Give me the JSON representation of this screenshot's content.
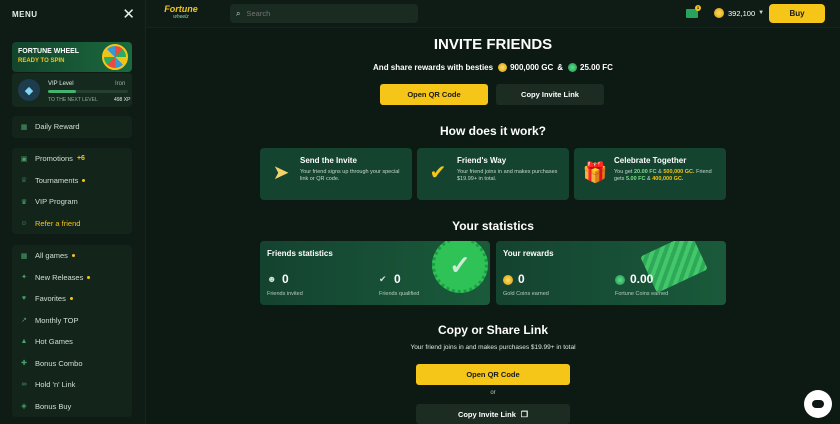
{
  "sidebar": {
    "menu_label": "MENU",
    "fortune_wheel": {
      "title": "FORTUNE WHEEL",
      "status": "READY TO SPIN"
    },
    "vip": {
      "label": "VIP Level",
      "rank": "Iron",
      "next_label": "TO THE NEXT LEVEL",
      "xp": "498 XP",
      "progress": 0.35
    },
    "group1": [
      {
        "label": "Daily Reward",
        "icon": "calendar-icon"
      }
    ],
    "group2": [
      {
        "label": "Promotions",
        "icon": "gift-icon",
        "extra": "+6"
      },
      {
        "label": "Tournaments",
        "icon": "trophy-icon",
        "dot": true
      },
      {
        "label": "VIP Program",
        "icon": "crown-icon"
      },
      {
        "label": "Refer a friend",
        "icon": "users-icon",
        "accent": true
      }
    ],
    "group3": [
      {
        "label": "All games",
        "icon": "grid-icon",
        "dot": true
      },
      {
        "label": "New Releases",
        "icon": "sparkle-icon",
        "dot": true
      },
      {
        "label": "Favorites",
        "icon": "heart-icon",
        "dot": true
      },
      {
        "label": "Monthly TOP",
        "icon": "trending-icon"
      },
      {
        "label": "Hot Games",
        "icon": "fire-icon"
      },
      {
        "label": "Bonus Combo",
        "icon": "combo-icon"
      },
      {
        "label": "Hold 'n' Link",
        "icon": "link-icon"
      },
      {
        "label": "Bonus Buy",
        "icon": "cart-icon"
      }
    ]
  },
  "topbar": {
    "logo_main": "Fortune",
    "logo_sub": "wheelz",
    "search_placeholder": "Search",
    "notification_count": "1",
    "balance": "392,100",
    "buy_label": "Buy"
  },
  "invite": {
    "title": "INVITE FRIENDS",
    "subtitle": "And share rewards with besties",
    "gc_amount": "900,000",
    "gc_unit": "GC",
    "amp": "&",
    "fc_amount": "25.00",
    "fc_unit": "FC",
    "qr_button": "Open QR Code",
    "copy_button": "Copy Invite Link"
  },
  "how": {
    "title": "How does it work?",
    "cards": [
      {
        "title": "Send the Invite",
        "desc": "Your friend signs up through your special link or QR code.",
        "icon": "paper-plane-icon"
      },
      {
        "title": "Friend's Way",
        "desc": "Your friend joins in and makes purchases $19.99+ in total.",
        "icon": "badge-check-icon"
      },
      {
        "title": "Celebrate Together",
        "desc_pre": "You get",
        "desc_fc": "20.00 FC",
        "desc_and": "&",
        "desc_gc": "500,000 GC.",
        "desc_mid": "Friend gets",
        "desc_fc2": "5.00 FC",
        "desc_and2": "&",
        "desc_gc2": "400,000 GC.",
        "icon": "gift-box-icon"
      }
    ]
  },
  "stats": {
    "title": "Your statistics",
    "friends": {
      "title": "Friends statistics",
      "invited_value": "0",
      "invited_label": "Friends invited",
      "qualified_value": "0",
      "qualified_label": "Friends qualified"
    },
    "rewards": {
      "title": "Your rewards",
      "gc_value": "0",
      "gc_label": "Gold Coins earned",
      "fc_value": "0.00",
      "fc_label": "Fortune Coins earned"
    }
  },
  "share": {
    "title": "Copy or Share Link",
    "subtitle": "Your friend joins in and makes purchases $19.99+ in total",
    "qr_button": "Open QR Code",
    "or": "or",
    "copy_button": "Copy Invite Link"
  },
  "colors": {
    "accent": "#f5c518",
    "bg": "#0d1a13",
    "card": "#144330",
    "green": "#2ec257"
  }
}
